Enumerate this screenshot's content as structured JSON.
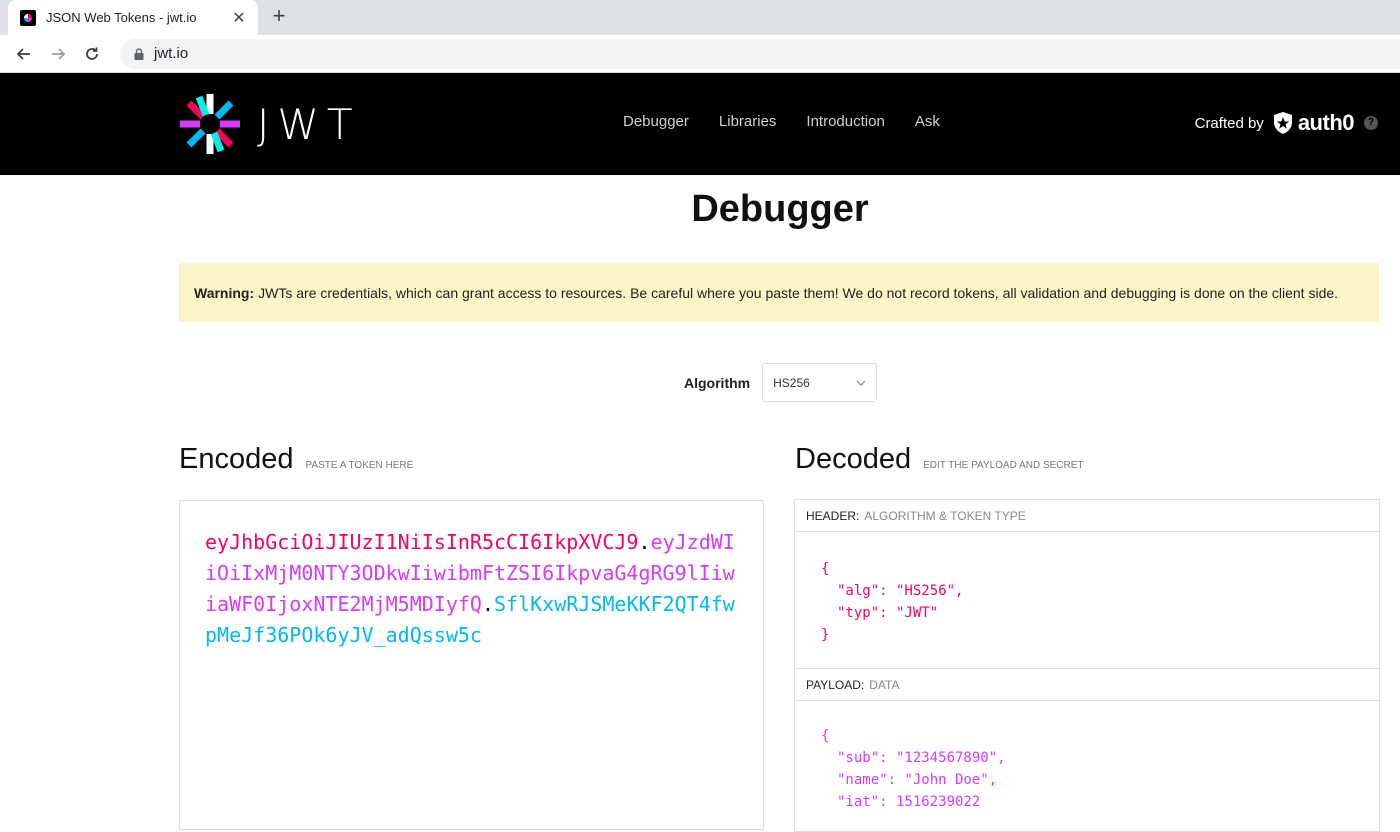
{
  "browser": {
    "tab_title": "JSON Web Tokens - jwt.io",
    "tab_close": "✕",
    "new_tab": "+",
    "url": "jwt.io"
  },
  "site": {
    "logo_text": "JWT",
    "nav": [
      "Debugger",
      "Libraries",
      "Introduction",
      "Ask"
    ],
    "crafted_by": "Crafted by",
    "brand": "auth0",
    "help": "?"
  },
  "page": {
    "title": "Debugger",
    "warning_bold": "Warning:",
    "warning_text": "JWTs are credentials, which can grant access to resources. Be careful where you paste them! We do not record tokens, all validation and debugging is done on the client side.",
    "algorithm_label": "Algorithm",
    "algorithm_value": "HS256"
  },
  "encoded": {
    "title": "Encoded",
    "subtitle": "PASTE A TOKEN HERE",
    "token_header": "eyJhbGciOiJIUzI1NiIsInR5cCI6IkpXVCJ9",
    "token_payload": "eyJzdWIiOiIxMjM0NTY3ODkwIiwibmFtZSI6IkpvaG4gRG9lIiwiaWF0IjoxNTE2MjM5MDIyfQ",
    "token_signature": "SflKxwRJSMeKKF2QT4fwpMeJf36POk6yJV_adQssw5c",
    "dot": "."
  },
  "decoded": {
    "title": "Decoded",
    "subtitle": "EDIT THE PAYLOAD AND SECRET",
    "header_label": "HEADER:",
    "header_desc": "ALGORITHM & TOKEN TYPE",
    "header_open": "{",
    "header_line1": "\"alg\": \"HS256\",",
    "header_line2": "\"typ\": \"JWT\"",
    "header_close": "}",
    "payload_label": "PAYLOAD:",
    "payload_desc": "DATA",
    "payload_open": "{",
    "payload_line1": "\"sub\": \"1234567890\",",
    "payload_line2": "\"name\": \"John Doe\",",
    "payload_line3": "\"iat\": 1516239022"
  },
  "colors": {
    "header": "#fb015b",
    "payload": "#d63aff",
    "signature": "#00b9f1",
    "warning_bg": "#fbf5c7"
  }
}
